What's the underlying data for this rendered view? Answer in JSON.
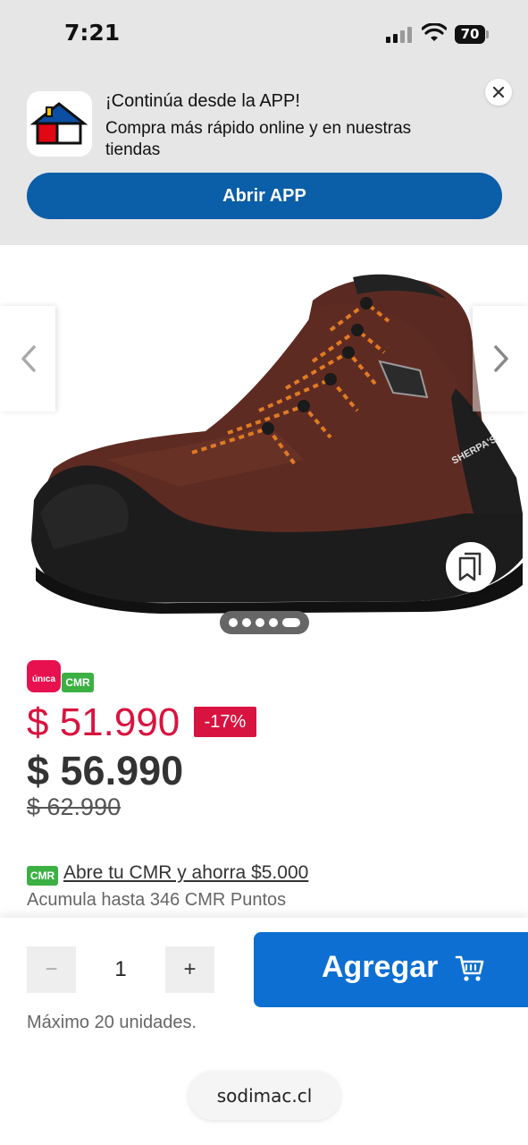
{
  "status_bar": {
    "time": "7:21",
    "battery": "70"
  },
  "app_banner": {
    "title": "¡Continúa desde la APP!",
    "text": "Compra más rápido online y en nuestras tiendas",
    "button": "Abrir APP"
  },
  "product": {
    "image_brand_text": "SHERPA'S",
    "carousel": {
      "total": 5,
      "active": 5
    }
  },
  "pricing": {
    "badge_unica": "únıca",
    "badge_cmr": "CMR",
    "cmr_price": "$ 51.990",
    "discount": "-17%",
    "internet_price": "$ 56.990",
    "normal_price": "$ 62.990",
    "cmr_link": "Abre tu CMR y ahorra $5.000",
    "cmr_points": "Acumula hasta 346 CMR Puntos"
  },
  "cart": {
    "minus": "−",
    "quantity": "1",
    "plus": "+",
    "add_label": "Agregar",
    "max_units": "Máximo 20 unidades."
  },
  "browser": {
    "url": "sodimac.cl"
  },
  "colors": {
    "banner_button": "#0b5ea8",
    "add_button": "#0d6fd1",
    "cmr_red": "#d9133f",
    "cmr_green": "#3cb043"
  }
}
